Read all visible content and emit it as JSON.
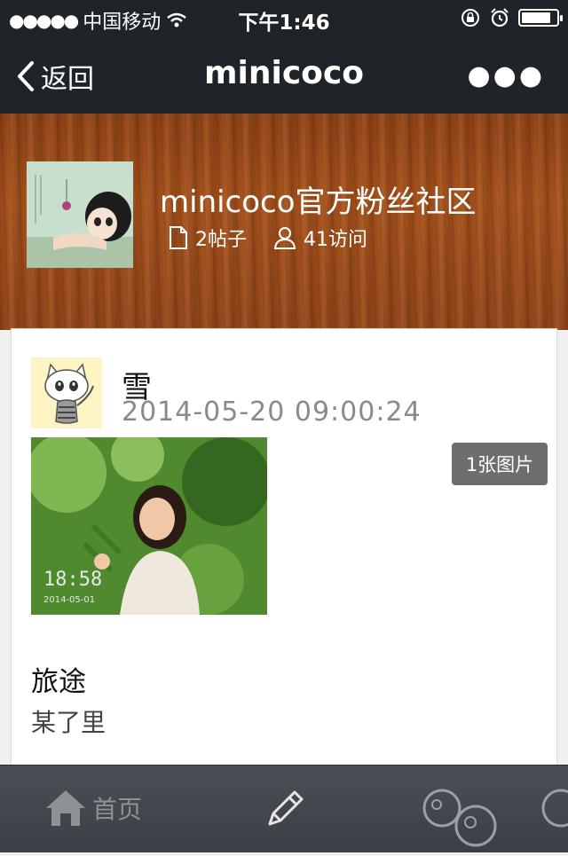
{
  "status_bar": {
    "carrier": "中国移动",
    "time": "下午1:46",
    "battery_level": 0.85
  },
  "nav": {
    "back_label": "返回",
    "title": "minicoco"
  },
  "community": {
    "name": "minicoco官方粉丝社区",
    "posts_label": "2帖子",
    "visits_label": "41访问"
  },
  "post": {
    "author": "雪",
    "timestamp": "2014-05-20 09:00:24",
    "photo_count_label": "1张图片",
    "photo_overlay_time": "18:58",
    "photo_overlay_date": "2014-05-01",
    "title": "旅途",
    "body": "某了里"
  },
  "tab_bar": {
    "home_label": "首页"
  },
  "colors": {
    "bar_dark": "#1f2429",
    "wood": "#a5521c",
    "tab_bar": "#3b4046"
  }
}
